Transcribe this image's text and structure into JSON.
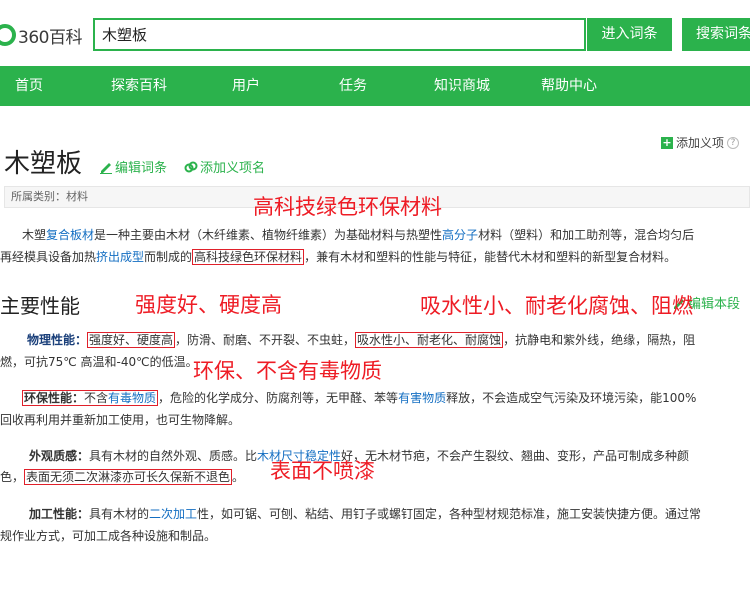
{
  "header": {
    "logo_num": "360",
    "logo_word": "百科",
    "search_value": "木塑板",
    "enter_button": "进入词条",
    "search_button": "搜索词条"
  },
  "nav": [
    "首页",
    "探索百科",
    "用户",
    "任务",
    "知识商城",
    "帮助中心"
  ],
  "title_area": {
    "add_meaning": "添加义项",
    "title": "木塑板",
    "edit_entry": "编辑词条",
    "add_name": "添加义项名",
    "category": "所属类别：材料"
  },
  "intro": {
    "l1_a": "木塑",
    "l1_link1": "复合板材",
    "l1_b": "是一种主要由木材（木纤维素、植物纤维素）为基础材料与热塑性",
    "l1_link2": "高分子",
    "l1_c": "材料（塑料）和加工助剂等，混合均匀后",
    "l2_a": "再经模具设备加热",
    "l2_link": "挤出成型",
    "l2_b": "而制成的",
    "l2_box": "高科技绿色环保材料",
    "l2_c": "，兼有木材和塑料的性能与特征，能替代木材和塑料的新型复合材料。"
  },
  "section": {
    "title": "主要性能",
    "edit": "编辑本段"
  },
  "physical": {
    "label": "物理性能：",
    "box1": "强度好、硬度高",
    "a": "，防滑、耐磨、不开裂、不虫蛀，",
    "box2": "吸水性小、耐老化、耐腐蚀",
    "b": "，抗静电和紫外线，绝缘，隔热，阻",
    "l2": "燃，可抗75℃ 高温和-40℃的低温。"
  },
  "env": {
    "label": "环保性能：",
    "box_a": "不含",
    "box_link": "有毒物质",
    "a": "，危险的化学成分、防腐剂等，无甲醛、苯等",
    "link2": "有害物质",
    "b": "释放，不会造成空气污染及环境污染，能100%",
    "l2": "回收再利用并重新加工使用，也可生物降解。"
  },
  "appearance": {
    "label": "外观质感：",
    "a": "具有木材的自然外观、质感。比",
    "link": "木材尺寸稳定性",
    "b": "好，无木材节疤，不会产生裂纹、翘曲、变形，产品可制成多种颜",
    "l2_a": "色，",
    "box": "表面无须二次淋漆亦可长久保新不退色",
    "l2_b": "。"
  },
  "processing": {
    "label": "加工性能：",
    "a": "具有木材的",
    "link": "二次加工",
    "b": "性，如可锯、可刨、粘结、用钉子或螺钉固定，各种型材规范标准，施工安装快捷方便。通过常",
    "l2": "规作业方式，可加工成各种设施和制品。"
  },
  "annotations": {
    "a1": "高科技绿色环保材料",
    "a2": "强度好、硬度高",
    "a3": "吸水性小、耐老化腐蚀、阻燃",
    "a4": "环保、不含有毒物质",
    "a5": "表面不喷漆"
  },
  "colors": {
    "brand": "#2bb24c",
    "link": "#136ec2",
    "annotation": "#ee1c25"
  }
}
